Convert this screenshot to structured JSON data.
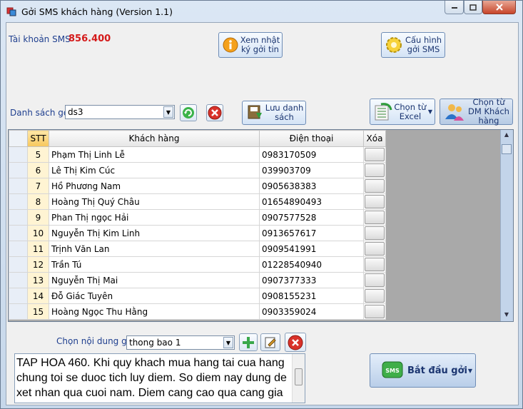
{
  "window": {
    "title": "Gởi SMS khách hàng (Version 1.1)"
  },
  "account": {
    "label": "Tài khoản SMS",
    "balance": "856.400"
  },
  "buttons": {
    "view_log": "Xem nhật ký gởi tin",
    "configure": "Cấu hình gởi SMS",
    "save_list": "Lưu danh sách",
    "from_excel": "Chọn từ Excel",
    "from_dm": "Chọn từ DM Khách hàng",
    "start": "Bắt đầu gởi"
  },
  "send_list": {
    "label": "Danh sách gởi",
    "value": "ds3"
  },
  "grid": {
    "columns": [
      "STT",
      "Khách hàng",
      "Điện thoại",
      "Xóa"
    ],
    "rows": [
      {
        "stt": "5",
        "name": "Phạm Thị Linh Lễ",
        "phone": "0983170509"
      },
      {
        "stt": "6",
        "name": "Lê Thị Kim Cúc",
        "phone": "039903709"
      },
      {
        "stt": "7",
        "name": "Hồ Phương Nam",
        "phone": "0905638383"
      },
      {
        "stt": "8",
        "name": "Hoàng Thị Quý Châu",
        "phone": "01654890493"
      },
      {
        "stt": "9",
        "name": "Phan Thị ngọc Hải",
        "phone": "0907577528"
      },
      {
        "stt": "10",
        "name": "Nguyễn Thị Kim Linh",
        "phone": "0913657617"
      },
      {
        "stt": "11",
        "name": "Trịnh Văn Lan",
        "phone": "0909541991"
      },
      {
        "stt": "12",
        "name": "Trần Tú",
        "phone": "01228540940"
      },
      {
        "stt": "13",
        "name": "Nguyễn Thị Mai",
        "phone": "0907377333"
      },
      {
        "stt": "14",
        "name": "Đỗ Giác Tuyên",
        "phone": "0908155231"
      },
      {
        "stt": "15",
        "name": "Hoàng Ngọc Thu Hằng",
        "phone": "0903359024"
      }
    ]
  },
  "content": {
    "label": "Chọn nội dung gởi",
    "value": "thong bao 1",
    "message": "TAP HOA 460. Khi quy khach mua hang tai cua hang chung toi se duoc tich luy diem. So diem nay dung de xet nhan qua cuoi nam. Diem cang cao qua cang gia tri."
  },
  "icons": [
    "app-icon",
    "minimize-icon",
    "maximize-icon",
    "close-icon",
    "info-icon",
    "gear-icon",
    "refresh-icon",
    "delete-icon",
    "save-icon",
    "excel-icon",
    "users-icon",
    "add-icon",
    "edit-icon",
    "sms-icon"
  ]
}
